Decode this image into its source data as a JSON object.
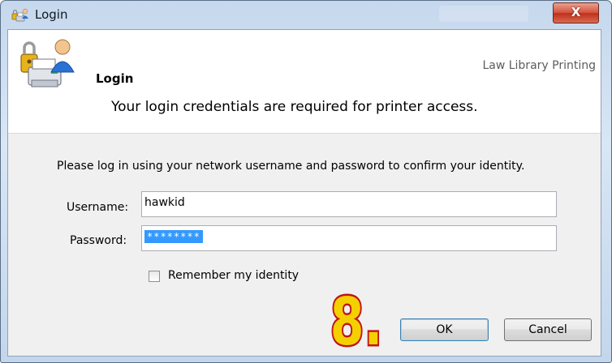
{
  "window": {
    "title": "Login",
    "close_label": "X"
  },
  "header": {
    "title": "Login",
    "subtitle": "Your login credentials are required for printer access.",
    "context_label": "Law Library Printing"
  },
  "form": {
    "instructions": "Please log in using your network username and password to confirm your identity.",
    "username_label": "Username:",
    "username_value": "hawkid",
    "password_label": "Password:",
    "password_value": "********",
    "remember_label": "Remember my identity",
    "remember_checked": false
  },
  "buttons": {
    "ok": "OK",
    "cancel": "Cancel"
  },
  "overlay": {
    "step_number": "8."
  },
  "icons": {
    "app": "printer-lock-user-icon",
    "header": "printer-lock-user-icon"
  },
  "colors": {
    "selection": "#3399ff",
    "close_button": "#c7402a",
    "marker_fill": "#f5d000",
    "marker_outline": "#c0141b"
  }
}
